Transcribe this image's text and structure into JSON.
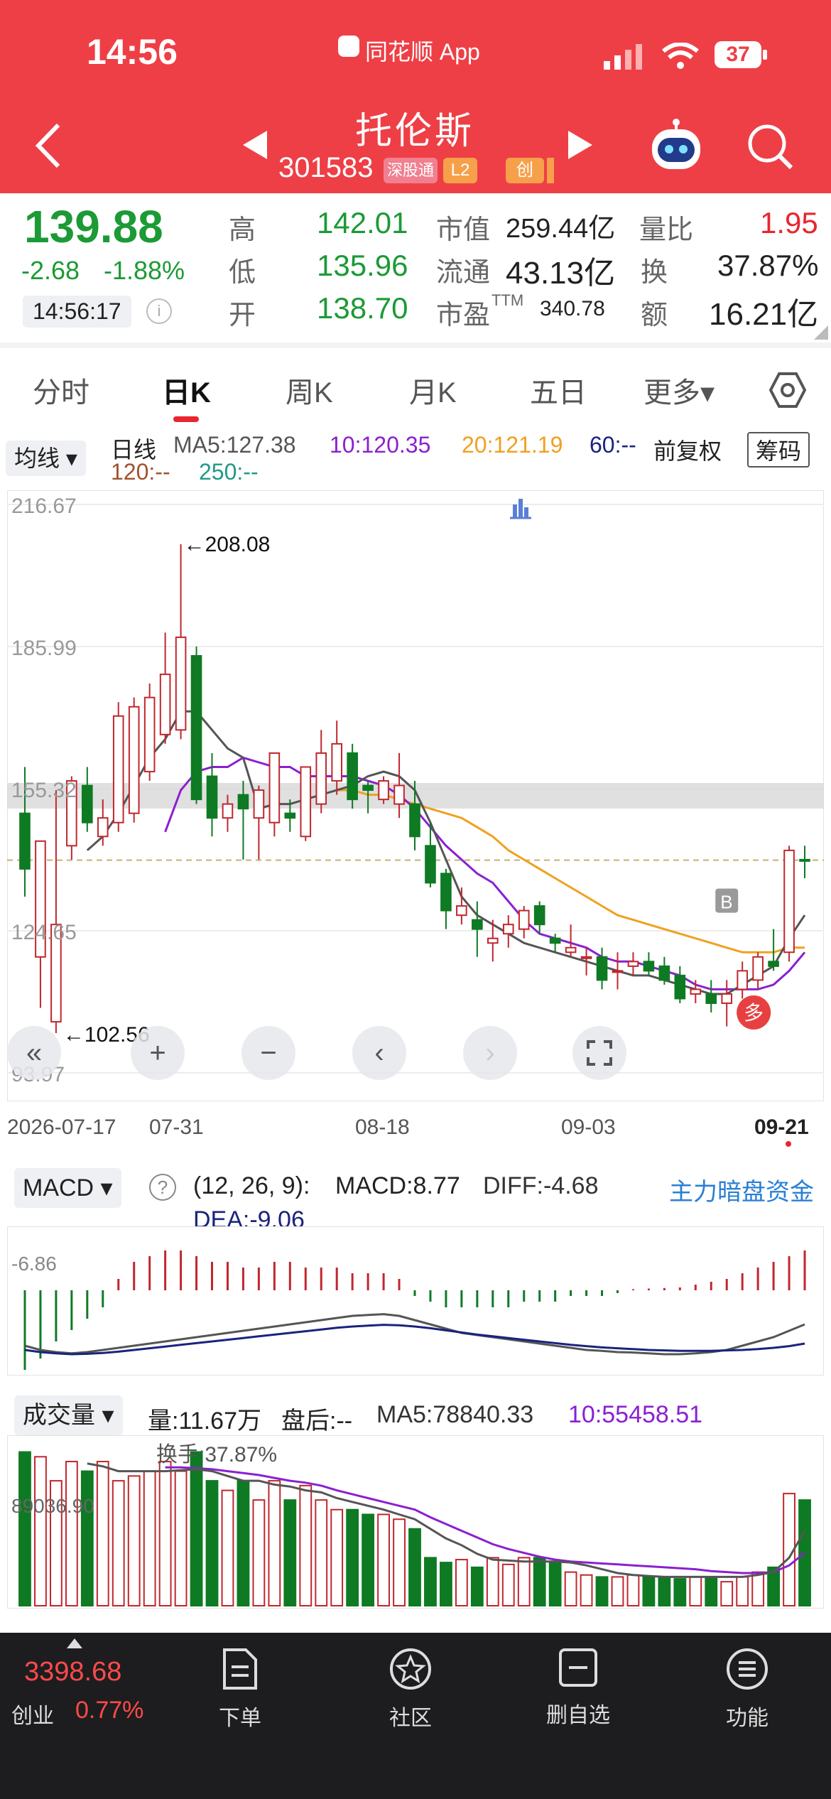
{
  "status_bar": {
    "time": "14:56",
    "app_name": "同花顺 App",
    "battery": "37"
  },
  "header": {
    "stock_name": "托伦斯",
    "stock_code": "301583",
    "badges": [
      "深股通",
      "L2",
      "创"
    ],
    "prev_icon": "triangle-left-icon",
    "next_icon": "triangle-right-icon",
    "robot_icon": "robot-icon",
    "search_icon": "search-icon"
  },
  "quote": {
    "price": "139.88",
    "change": "-2.68",
    "change_pct": "-1.88%",
    "time": "14:56:17",
    "high_label": "高",
    "high": "142.01",
    "low_label": "低",
    "low": "135.96",
    "open_label": "开",
    "open": "138.70",
    "mktcap_label": "市值",
    "mktcap": "259.44亿",
    "float_label": "流通",
    "float": "43.13亿",
    "pe_label": "市盈",
    "pe_sup": "TTM",
    "pe": "340.78",
    "vr_label": "量比",
    "vr": "1.95",
    "turnover_label": "换",
    "turnover": "37.87%",
    "amount_label": "额",
    "amount": "16.21亿"
  },
  "tabs": [
    {
      "label": "分时",
      "active": false
    },
    {
      "label": "日K",
      "active": true
    },
    {
      "label": "周K",
      "active": false
    },
    {
      "label": "月K",
      "active": false
    },
    {
      "label": "五日",
      "active": false
    },
    {
      "label": "更多▾",
      "active": false
    }
  ],
  "indicator_bar": {
    "selector": "均线",
    "period": "日线",
    "ma5": "MA5:127.38",
    "ma10": "10:120.35",
    "ma20": "20:121.19",
    "ma60": "60:--",
    "ma120": "120:--",
    "ma250": "250:--",
    "adjust": "前复权",
    "chips_button": "筹码"
  },
  "colors": {
    "header_bg": "#ee3f46",
    "up": "#c0272d",
    "down": "#0e7a23",
    "ma5": "#555555",
    "ma10": "#8b1fd1",
    "ma20": "#f0a020",
    "ma60": "#1a237e"
  },
  "kline": {
    "y_ticks": [
      "216.67",
      "185.99",
      "155.32",
      "124.65",
      "93.97"
    ],
    "high_mark": "208.08",
    "low_mark": "102.56",
    "x_labels": [
      "2026-07-17",
      "07-31",
      "08-18",
      "09-03",
      "09-21"
    ],
    "signal_B": "B",
    "signal_duo": "多",
    "candles": [
      {
        "o": 150,
        "h": 160,
        "l": 132,
        "c": 138
      },
      {
        "o": 119,
        "h": 138,
        "l": 108,
        "c": 144
      },
      {
        "o": 105,
        "h": 155,
        "l": 102.56,
        "c": 126
      },
      {
        "o": 143,
        "h": 158,
        "l": 140,
        "c": 157
      },
      {
        "o": 156,
        "h": 160,
        "l": 146,
        "c": 148
      },
      {
        "o": 145,
        "h": 153,
        "l": 143,
        "c": 149
      },
      {
        "o": 148,
        "h": 174,
        "l": 146,
        "c": 171
      },
      {
        "o": 150,
        "h": 175,
        "l": 148,
        "c": 173
      },
      {
        "o": 159,
        "h": 178,
        "l": 157,
        "c": 175
      },
      {
        "o": 167,
        "h": 189,
        "l": 165,
        "c": 180
      },
      {
        "o": 168,
        "h": 208.08,
        "l": 166,
        "c": 188
      },
      {
        "o": 184,
        "h": 186,
        "l": 152,
        "c": 153
      },
      {
        "o": 158,
        "h": 163,
        "l": 145,
        "c": 149
      },
      {
        "o": 149,
        "h": 154,
        "l": 146,
        "c": 152
      },
      {
        "o": 154,
        "h": 157,
        "l": 140,
        "c": 151
      },
      {
        "o": 149,
        "h": 156,
        "l": 140,
        "c": 155
      },
      {
        "o": 148,
        "h": 163,
        "l": 145,
        "c": 163
      },
      {
        "o": 150,
        "h": 153,
        "l": 146,
        "c": 149
      },
      {
        "o": 145,
        "h": 158,
        "l": 144,
        "c": 160
      },
      {
        "o": 152,
        "h": 168,
        "l": 150,
        "c": 163
      },
      {
        "o": 157,
        "h": 170,
        "l": 154,
        "c": 165
      },
      {
        "o": 163,
        "h": 165,
        "l": 151,
        "c": 153
      },
      {
        "o": 156,
        "h": 157,
        "l": 150,
        "c": 155
      },
      {
        "o": 153,
        "h": 158,
        "l": 152,
        "c": 157
      },
      {
        "o": 152,
        "h": 163,
        "l": 149,
        "c": 156
      },
      {
        "o": 152,
        "h": 157,
        "l": 142,
        "c": 145
      },
      {
        "o": 143,
        "h": 148,
        "l": 134,
        "c": 135
      },
      {
        "o": 137,
        "h": 138,
        "l": 125,
        "c": 129
      },
      {
        "o": 128,
        "h": 134,
        "l": 126,
        "c": 130
      },
      {
        "o": 127,
        "h": 131,
        "l": 119,
        "c": 125
      },
      {
        "o": 122,
        "h": 127,
        "l": 118,
        "c": 123
      },
      {
        "o": 124,
        "h": 128,
        "l": 121,
        "c": 126
      },
      {
        "o": 125,
        "h": 130,
        "l": 123,
        "c": 129
      },
      {
        "o": 130,
        "h": 131,
        "l": 124,
        "c": 126
      },
      {
        "o": 123,
        "h": 124,
        "l": 120,
        "c": 122
      },
      {
        "o": 120,
        "h": 126,
        "l": 119,
        "c": 121
      },
      {
        "o": 119,
        "h": 121,
        "l": 115,
        "c": 119
      },
      {
        "o": 119,
        "h": 121,
        "l": 112,
        "c": 114
      },
      {
        "o": 116,
        "h": 120,
        "l": 112,
        "c": 116
      },
      {
        "o": 117,
        "h": 120,
        "l": 115,
        "c": 118
      },
      {
        "o": 118,
        "h": 120,
        "l": 115,
        "c": 116
      },
      {
        "o": 117,
        "h": 119,
        "l": 113,
        "c": 114
      },
      {
        "o": 115,
        "h": 117,
        "l": 109,
        "c": 110
      },
      {
        "o": 111,
        "h": 114,
        "l": 109,
        "c": 112
      },
      {
        "o": 111,
        "h": 114,
        "l": 107,
        "c": 109
      },
      {
        "o": 109,
        "h": 114,
        "l": 104,
        "c": 111
      },
      {
        "o": 112,
        "h": 118,
        "l": 110,
        "c": 116
      },
      {
        "o": 114,
        "h": 120,
        "l": 112,
        "c": 119
      },
      {
        "o": 118,
        "h": 125,
        "l": 116,
        "c": 117
      },
      {
        "o": 120,
        "h": 143,
        "l": 118,
        "c": 142
      },
      {
        "o": 140,
        "h": 143,
        "l": 136,
        "c": 139.88
      }
    ],
    "ma5": [
      null,
      null,
      null,
      null,
      142,
      145,
      150,
      156,
      162,
      166,
      172,
      172,
      168,
      164,
      162,
      151,
      152,
      152,
      153,
      154,
      155,
      156,
      158,
      159,
      158,
      155,
      148,
      140,
      132,
      128,
      126,
      124,
      122,
      121,
      120,
      119,
      118,
      117,
      116,
      115,
      115,
      114,
      113,
      112,
      111,
      111,
      113,
      115,
      117,
      123,
      128
    ],
    "ma10": [
      null,
      null,
      null,
      null,
      null,
      null,
      null,
      null,
      null,
      146,
      155,
      159,
      160,
      160,
      162,
      161,
      160,
      160,
      158,
      158,
      158,
      158,
      157,
      156,
      154,
      151,
      147,
      143,
      140,
      137,
      135,
      131,
      127,
      124,
      123,
      122,
      121,
      119,
      118,
      118,
      117,
      116,
      115,
      113,
      112,
      112,
      112,
      112,
      113,
      116,
      120
    ],
    "ma20": [
      null,
      null,
      null,
      null,
      null,
      null,
      null,
      null,
      null,
      null,
      null,
      null,
      null,
      null,
      null,
      null,
      null,
      null,
      null,
      null,
      155,
      155,
      154,
      154,
      153,
      152,
      151,
      150,
      149,
      147,
      145,
      142,
      140,
      138,
      136,
      134,
      132,
      130,
      128,
      127,
      126,
      125,
      124,
      123,
      122,
      121,
      120,
      120,
      120,
      121,
      121
    ]
  },
  "chart_controls": {
    "collapse": "«",
    "zoom_in": "+",
    "zoom_out": "−",
    "prev": "‹",
    "next": "›",
    "fullscreen": "fullscreen-icon"
  },
  "macd": {
    "selector": "MACD",
    "params": "(12, 26, 9):",
    "macd_value": "MACD:8.77",
    "diff": "DIFF:-4.68",
    "dea": "DEA:-9.06",
    "axis_label": "-6.86",
    "link": "主力暗盘资金",
    "bars": [
      -14,
      -12,
      -9,
      -7,
      -5,
      -3,
      2,
      5,
      6,
      7,
      7,
      6,
      5,
      5,
      4,
      4,
      5,
      5,
      4,
      4,
      4,
      3,
      3,
      3,
      2,
      -1,
      -2,
      -3,
      -3,
      -3,
      -3,
      -3,
      -2,
      -2,
      -2,
      -1,
      -1,
      -1,
      -0.5,
      0.2,
      0.3,
      0.4,
      0.5,
      1,
      1.5,
      2,
      3,
      4,
      5,
      6,
      7
    ],
    "diff_line": [
      -8,
      -9,
      -9.5,
      -9.8,
      -9.5,
      -9,
      -8.5,
      -8,
      -7.5,
      -7,
      -6.5,
      -6,
      -5.5,
      -5,
      -4.5,
      -4,
      -3.5,
      -3,
      -2.5,
      -2,
      -1.5,
      -1,
      -0.8,
      -0.6,
      -1,
      -2,
      -3,
      -4,
      -5,
      -5.5,
      -6,
      -6.5,
      -7,
      -7.5,
      -8,
      -8.5,
      -9,
      -9.2,
      -9.5,
      -9.6,
      -9.8,
      -10,
      -10,
      -9.8,
      -9.5,
      -9,
      -8,
      -7,
      -6,
      -4.5,
      -3
    ],
    "dea_line": [
      -9,
      -9.5,
      -9.8,
      -10,
      -9.9,
      -9.7,
      -9.4,
      -9,
      -8.6,
      -8.2,
      -7.8,
      -7.4,
      -7,
      -6.6,
      -6.2,
      -5.8,
      -5.4,
      -5,
      -4.6,
      -4.2,
      -3.8,
      -3.5,
      -3.3,
      -3.1,
      -3.2,
      -3.5,
      -3.9,
      -4.4,
      -4.9,
      -5.4,
      -5.8,
      -6.2,
      -6.6,
      -7,
      -7.4,
      -7.8,
      -8.1,
      -8.4,
      -8.6,
      -8.8,
      -9,
      -9.1,
      -9.2,
      -9.2,
      -9.2,
      -9.1,
      -9,
      -8.8,
      -8.5,
      -8.1,
      -7.5
    ]
  },
  "volume": {
    "selector": "成交量",
    "vol": "量:11.67万",
    "after_hours": "盘后:--",
    "ma5": "MA5:78840.33",
    "ma10": "10:55458.51",
    "turnover_label": "换手:37.87%",
    "axis_label": "89036.90",
    "bars": [
      16,
      15.5,
      13,
      15,
      14,
      15,
      13,
      13.5,
      14,
      15,
      14,
      16,
      13,
      12,
      13,
      11,
      13,
      11,
      12.5,
      11,
      10,
      10,
      9.5,
      9.5,
      9,
      8,
      5,
      4.5,
      4.8,
      4,
      5,
      4.3,
      5,
      5,
      4.5,
      3.5,
      3.2,
      3,
      3,
      3.2,
      3,
      3,
      2.8,
      3,
      3,
      2.5,
      3,
      3.5,
      4,
      11.67,
      11
    ],
    "ma5_line": [
      null,
      null,
      null,
      null,
      14.8,
      14.5,
      14,
      14,
      14,
      14,
      14.1,
      14.2,
      14,
      13.5,
      13,
      13,
      12.6,
      12.4,
      12,
      11.8,
      11.2,
      10.8,
      10.4,
      10,
      9.5,
      9,
      8,
      7,
      6.3,
      5.4,
      4.8,
      4.7,
      4.6,
      4.6,
      4.6,
      4.5,
      4.2,
      3.8,
      3.4,
      3.2,
      3.1,
      3,
      3,
      3,
      3,
      3,
      3,
      3.2,
      3.5,
      5,
      7.8
    ],
    "ma10_line": [
      null,
      null,
      null,
      null,
      null,
      null,
      null,
      null,
      null,
      14.4,
      14.4,
      14.3,
      14.2,
      14,
      13.8,
      13.6,
      13.3,
      13,
      12.8,
      12.5,
      12,
      11.6,
      11.2,
      10.8,
      10.4,
      10,
      9.2,
      8.5,
      7.8,
      7.1,
      6.4,
      5.9,
      5.5,
      5.1,
      4.8,
      4.6,
      4.5,
      4.4,
      4.3,
      4.2,
      4.1,
      4,
      3.9,
      3.8,
      3.6,
      3.5,
      3.4,
      3.4,
      3.5,
      4.2,
      5.5
    ]
  },
  "bottom_nav": {
    "index_value": "3398.68",
    "index_name": "创业",
    "index_pct": "0.77%",
    "items": [
      {
        "label": "下单",
        "icon": "document-icon"
      },
      {
        "label": "社区",
        "icon": "star-icon"
      },
      {
        "label": "删自选",
        "icon": "minus-box-icon"
      },
      {
        "label": "功能",
        "icon": "menu-icon"
      }
    ]
  }
}
